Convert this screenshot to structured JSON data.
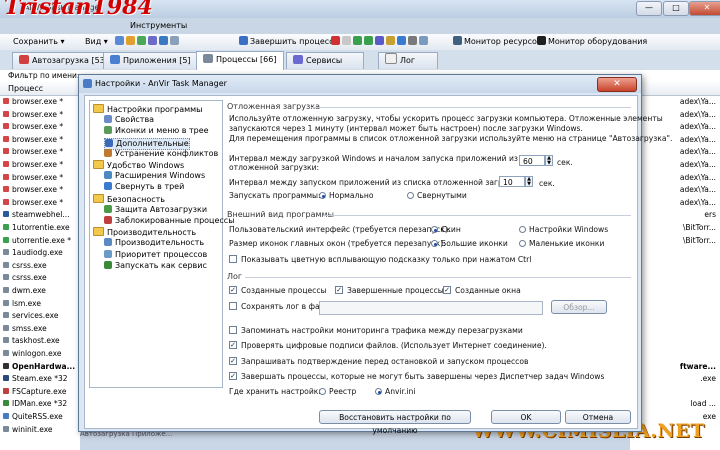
{
  "watermark_top": "Tristan1984",
  "app_title": "AnVir Task Manager",
  "menu": [
    "Файл",
    "Вид",
    "Инструменты",
    "Справка"
  ],
  "toolbar": {
    "save": "Сохранить",
    "view": "Вид",
    "end_process": "Завершить процесс",
    "resource_monitor": "Монитор ресурсов",
    "hardware_monitor": "Монитор оборудования"
  },
  "tabs": [
    {
      "label": "Автозагрузка [536]",
      "icon": "startup-icon"
    },
    {
      "label": "Приложения [5]",
      "icon": "applications-icon"
    },
    {
      "label": "Процессы [66]",
      "icon": "processes-icon"
    },
    {
      "label": "Сервисы",
      "icon": "services-icon"
    },
    {
      "label": "Лог",
      "icon": "log-icon"
    }
  ],
  "filter_label": "Фильтр по имени:",
  "column_process": "Процесс",
  "processes": [
    "browser.exe *",
    "browser.exe *",
    "browser.exe *",
    "browser.exe *",
    "browser.exe *",
    "browser.exe *",
    "browser.exe *",
    "browser.exe *",
    "browser.exe *",
    "steamwebhel...",
    "1utorrentie.exe",
    "utorrentie.exe *",
    "1audiodg.exe",
    "csrss.exe",
    "csrss.exe",
    "dwm.exe",
    "lsm.exe",
    "services.exe",
    "smss.exe",
    "taskhost.exe",
    "winlogon.exe",
    "OpenHardwa...",
    "Steam.exe *32",
    "FSCapture.exe",
    "IDMan.exe *32",
    "QuiteRSS.exe",
    "wininit.exe"
  ],
  "right_column": [
    "adex\\Ya...",
    "adex\\Ya...",
    "adex\\Ya...",
    "adex\\Ya...",
    "adex\\Ya...",
    "adex\\Ya...",
    "adex\\Ya...",
    "adex\\Ya...",
    "adex\\Ya...",
    "ers",
    "\\BitTorr...",
    "\\BitTorr...",
    "",
    "",
    "",
    "",
    "",
    "",
    "",
    "",
    "",
    "ftware...",
    ".exe",
    "",
    "load ...",
    "exe",
    ""
  ],
  "bottom_row_text": "Автозагрузка Приложе...",
  "watermark_bottom": "WWW.CIMISLIA.NET",
  "dialog": {
    "title": "Настройки - AnVir Task Manager",
    "close": "✕",
    "tree": [
      {
        "label": "Настройки программы",
        "type": "folder",
        "level": 0
      },
      {
        "label": "Свойства",
        "type": "leaf",
        "level": 1
      },
      {
        "label": "Иконки и меню в трее",
        "type": "leaf",
        "level": 1
      },
      {
        "label": "Дополнительные",
        "type": "leaf",
        "level": 1,
        "selected": true
      },
      {
        "label": "Устранение конфликтов",
        "type": "leaf",
        "level": 1
      },
      {
        "label": "Удобство Windows",
        "type": "folder",
        "level": 0
      },
      {
        "label": "Расширения Windows",
        "type": "leaf",
        "level": 1
      },
      {
        "label": "Свернуть в трей",
        "type": "leaf",
        "level": 1
      },
      {
        "label": "Безопасность",
        "type": "folder",
        "level": 0
      },
      {
        "label": "Защита Автозагрузки",
        "type": "leaf",
        "level": 1
      },
      {
        "label": "Заблокированные процессы",
        "type": "leaf",
        "level": 1
      },
      {
        "label": "Производительность",
        "type": "folder",
        "level": 0
      },
      {
        "label": "Производительность",
        "type": "leaf",
        "level": 1
      },
      {
        "label": "Приоритет процессов",
        "type": "leaf",
        "level": 1
      },
      {
        "label": "Запускать как сервис",
        "type": "leaf",
        "level": 1
      }
    ],
    "delayed": {
      "title": "Отложенная загрузка",
      "desc1": "Используйте отложенную загрузку, чтобы ускорить процесс загрузки компьютера. Отложенные элементы",
      "desc2": "запускаются через 1 минуту (интервал может быть настроен) после загрузки Windows.",
      "desc3": "Для перемещения программы в список отложенной загрузки используйте меню на странице \"Автозагрузка\".",
      "interval1_line1": "Интервал между загрузкой Windows и началом запуска приложений из списка",
      "interval1_line2": "отложенной загрузки:",
      "interval1_value": "60",
      "unit1": "сек.",
      "interval2": "Интервал между запуском приложений из списка отложенной загрузки:",
      "interval2_value": "10",
      "unit2": "сек.",
      "run_label": "Запускать программы:",
      "run_normal": "Нормально",
      "run_minimized": "Свернутыми"
    },
    "appearance": {
      "title": "Внешний вид программы",
      "ui_label": "Пользовательский интерфейс (требуется перезапуск):",
      "ui_skin": "Скин",
      "ui_windows": "Настройки Windows",
      "icon_label": "Размер иконок главных окон (требуется перезапуск):",
      "icon_large": "Большие иконки",
      "icon_small": "Маленькие иконки",
      "tooltip_ctrl": "Показывать цветную всплывающую подсказку только при нажатом Ctrl"
    },
    "log": {
      "title": "Лог",
      "created_processes": "Созданные процессы",
      "finished_processes": "Завершенные процессы",
      "created_windows": "Созданные окна",
      "save_to_file": "Сохранять лог в файл",
      "browse": "Обзор..."
    },
    "options": {
      "remember_traffic": "Запоминать настройки мониторинга трафика между перезагрузками",
      "check_signatures": "Проверять цифровые подписи файлов. (Использует Интернет соединение).",
      "confirm_stop": "Запрашивать подтверждение перед остановкой и запуском процессов",
      "kill_hung": "Завершать процессы, которые не могут быть завершены через Диспетчер задач Windows",
      "store_label": "Где хранить настройки:",
      "store_registry": "Реестр",
      "store_ini": "Anvir.ini"
    },
    "buttons": {
      "restore_defaults": "Восстановить настройки по умолчанию",
      "ok": "OK",
      "cancel": "Отмена"
    }
  }
}
